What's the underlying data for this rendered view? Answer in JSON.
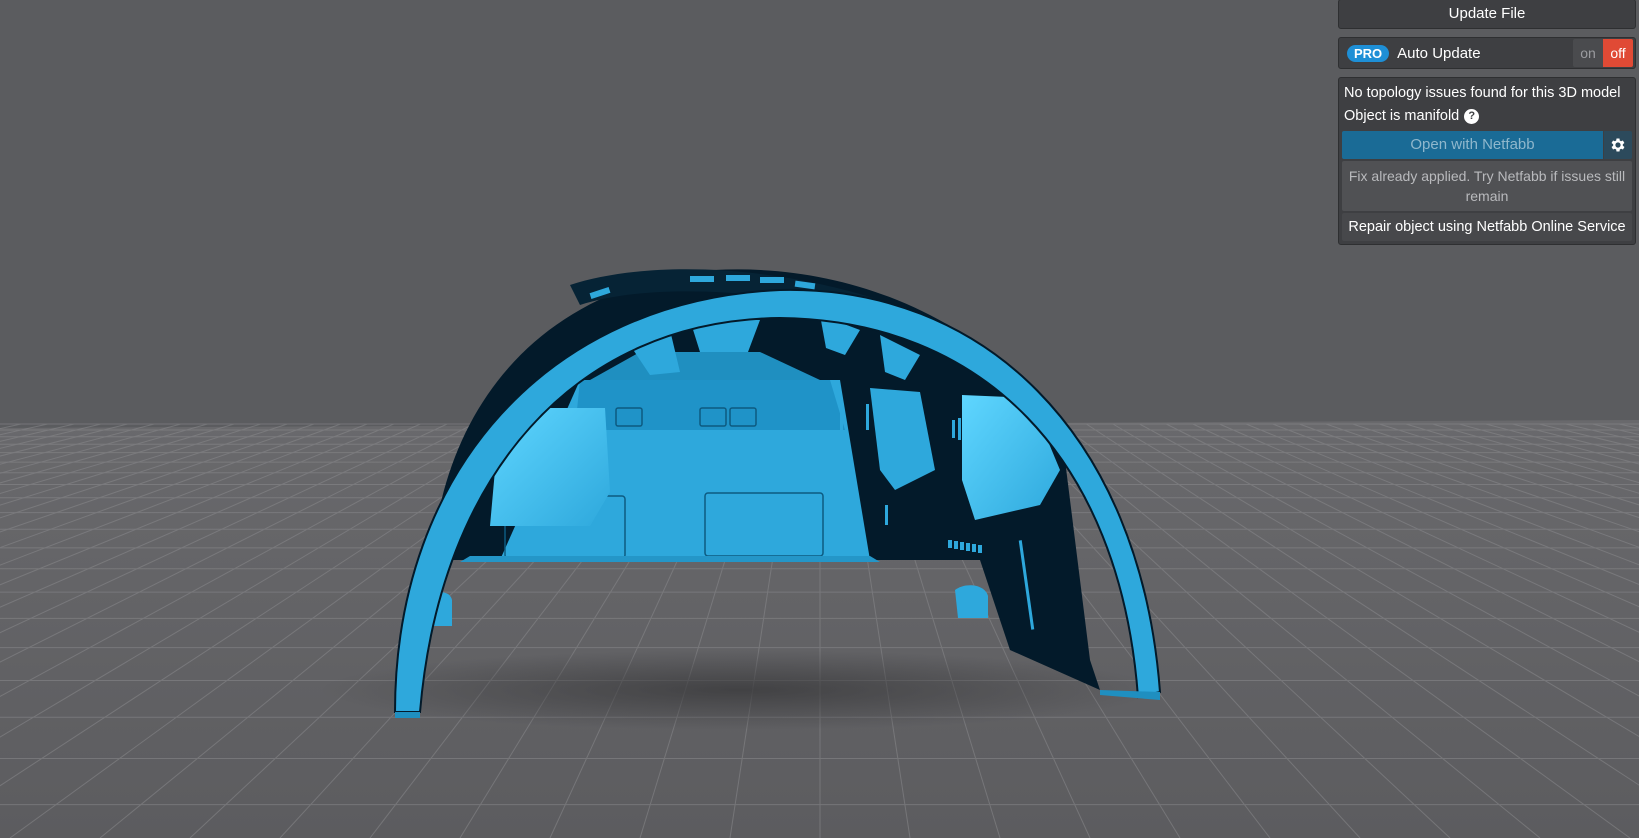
{
  "panel": {
    "update_file_label": "Update File",
    "pro_badge": "PRO",
    "auto_update_label": "Auto Update",
    "toggle_on_label": "on",
    "toggle_off_label": "off",
    "auto_update_state": "off",
    "report_line_1": "No topology issues found for this 3D model",
    "report_line_2": "Object is manifold",
    "help_glyph": "?",
    "open_netfabb_label": "Open with Netfabb",
    "fix_note": "Fix already applied. Try Netfabb if issues still remain",
    "repair_label": "Repair object using Netfabb Online Service"
  },
  "colors": {
    "background": "#5b5c5f",
    "model_blue": "#2ea8dc",
    "model_dark": "#031a2a",
    "pro_badge": "#1e8fd6",
    "toggle_off": "#e04a35",
    "netfabb_button": "#1a6b96"
  },
  "icons": {
    "help": "help-circle-icon",
    "settings": "gear-icon"
  }
}
